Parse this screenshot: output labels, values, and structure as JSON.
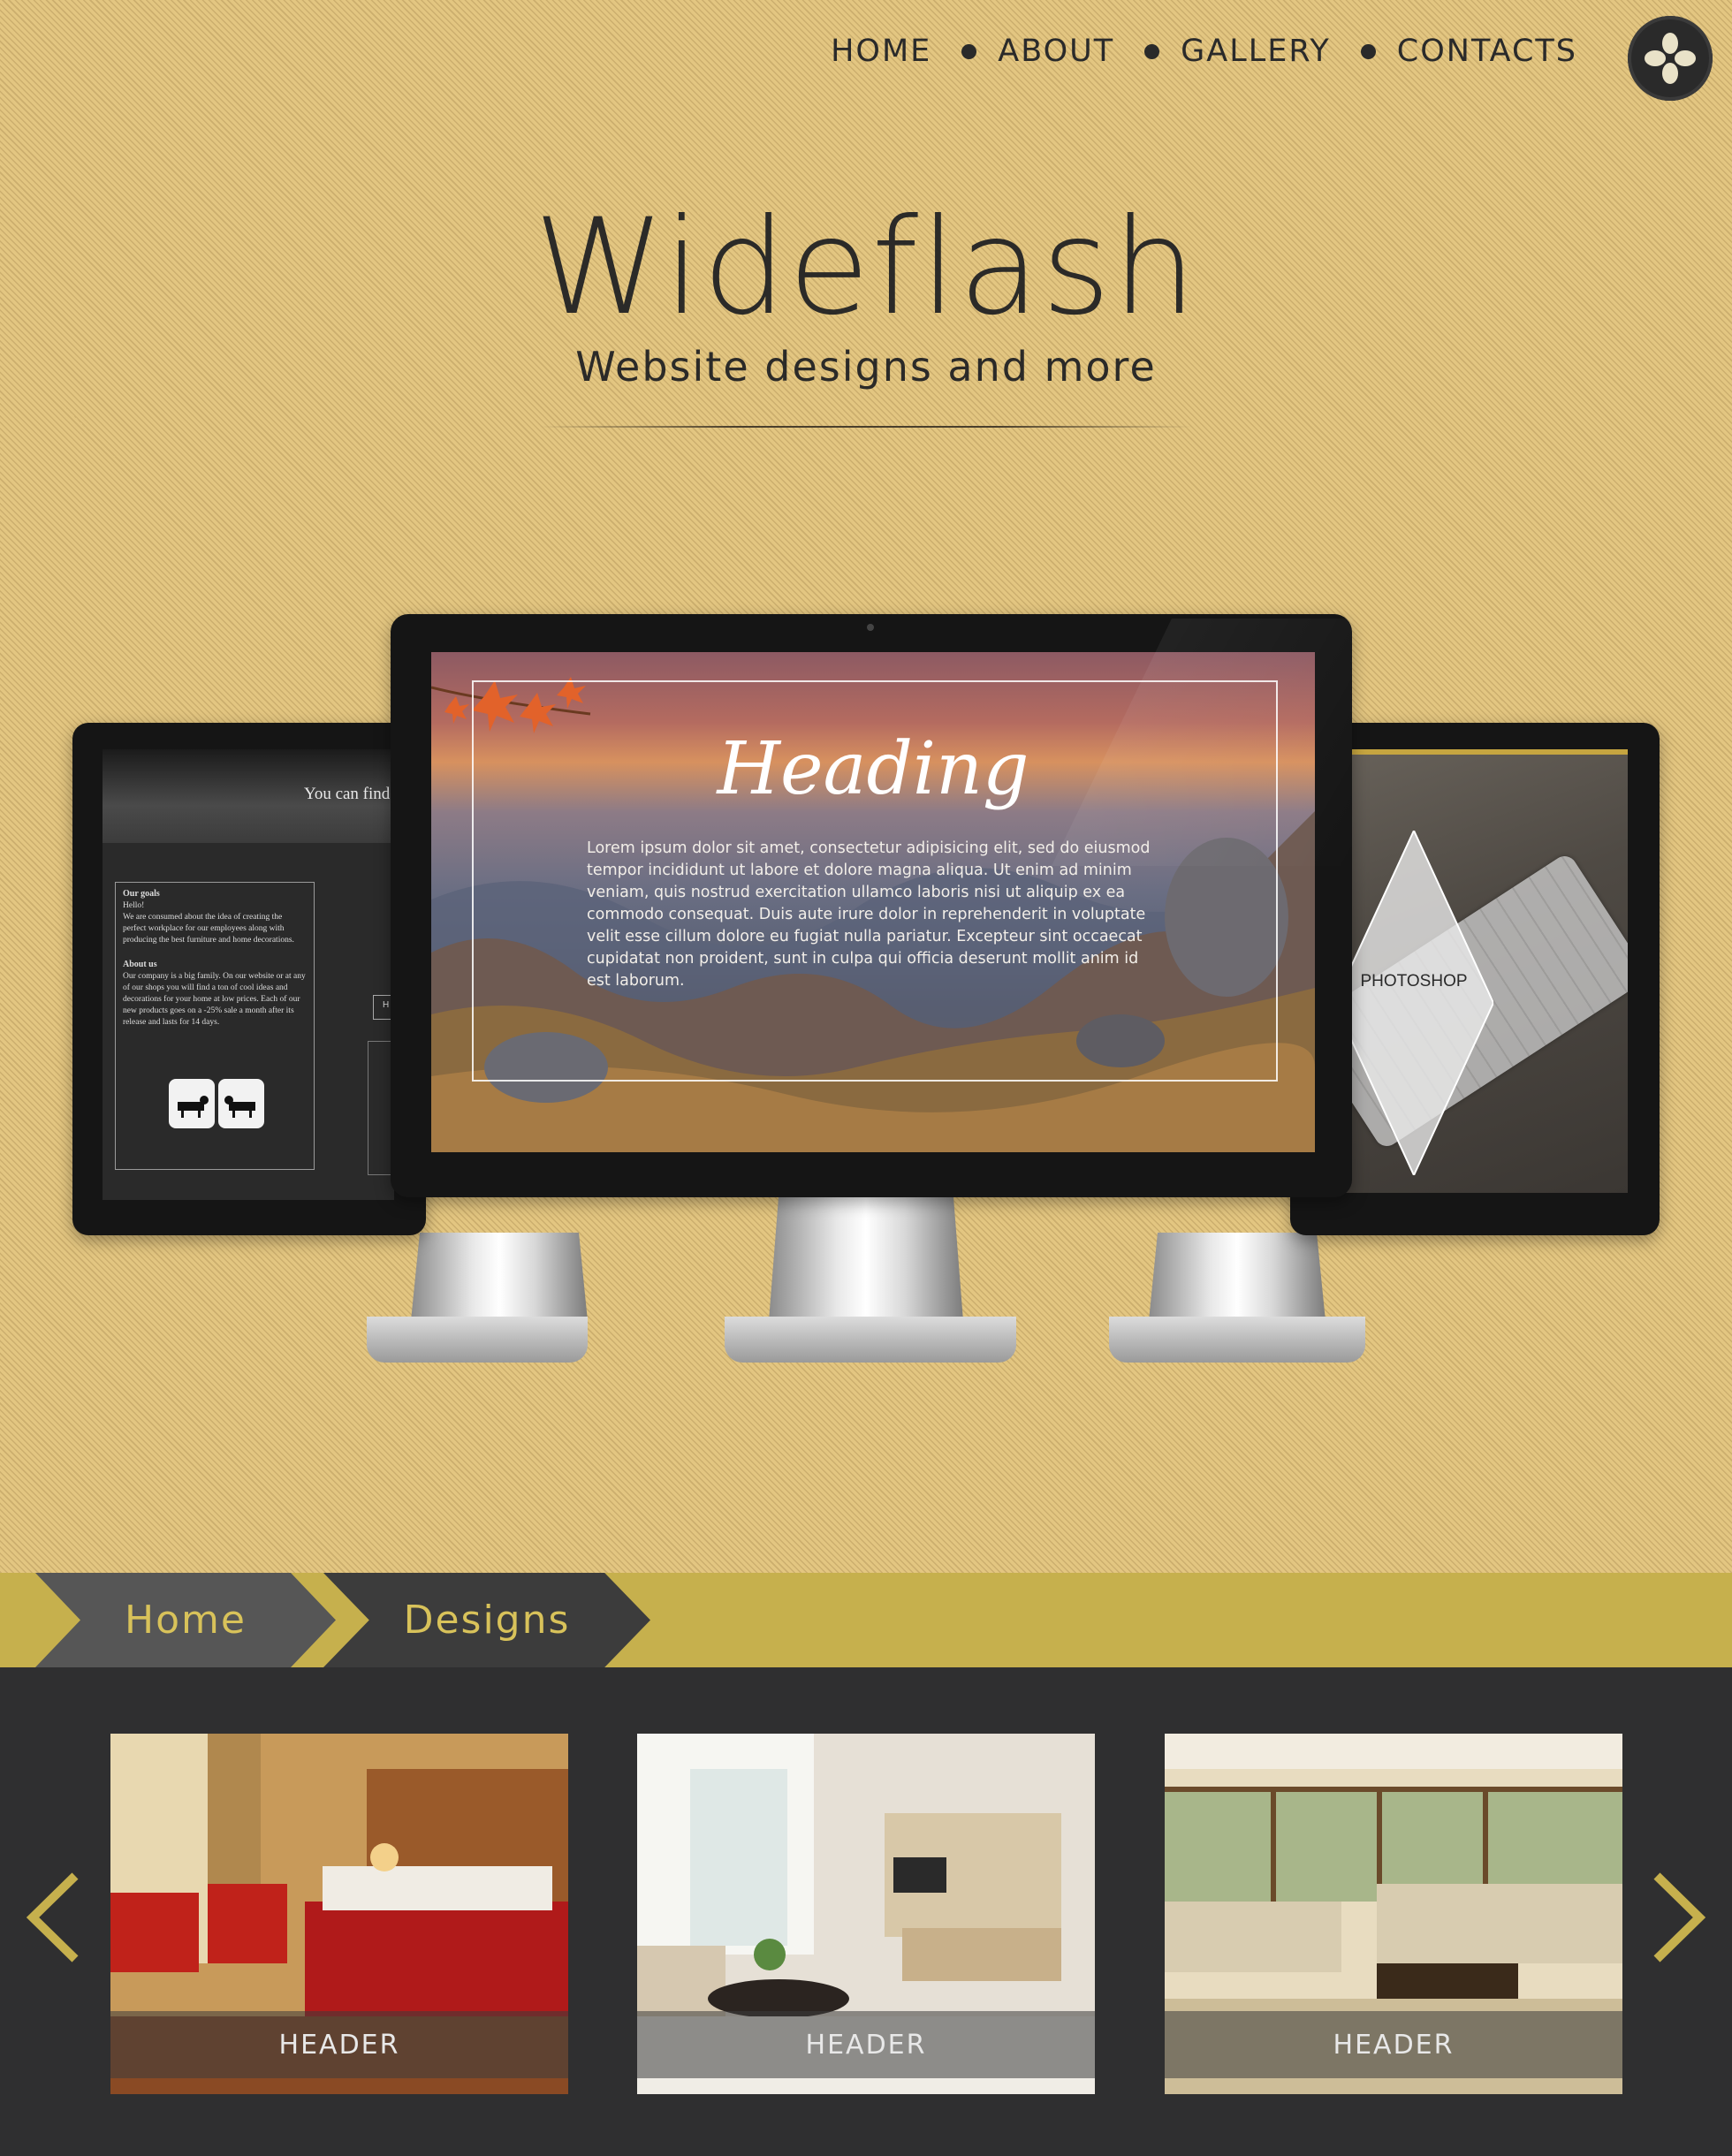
{
  "nav": {
    "items": [
      "HOME",
      "ABOUT",
      "GALLERY",
      "CONTACTS"
    ]
  },
  "hero": {
    "title": "Wideflash",
    "subtitle": "Website designs and more"
  },
  "left_screen": {
    "banner_text": "You can find",
    "goals_title": "Our goals",
    "goals_text": "Hello!\nWe are consumed about the idea of creating the perfect workplace for our employees along with producing the best furniture and home decorations.",
    "about_title": "About us",
    "about_text": "Our company is a big family. On our website or at any of our shops you will find a ton of cool ideas and decorations for your home at low prices. Each of our new products goes on a -25% sale a month after its release and lasts for 14 days.",
    "button_text": "H"
  },
  "center_screen": {
    "heading": "Heading",
    "body": "Lorem ipsum dolor sit amet, consectetur adipisicing elit, sed do eiusmod tempor incididunt ut labore et dolore magna aliqua. Ut enim ad minim veniam, quis nostrud exercitation ullamco laboris nisi ut aliquip ex ea commodo consequat. Duis aute irure dolor in reprehenderit in voluptate velit esse cillum dolore eu fugiat nulla pariatur. Excepteur sint occaecat cupidatat non proident, sunt in culpa qui officia deserunt mollit anim id est laborum."
  },
  "right_screen": {
    "label": "PHOTOSHOP"
  },
  "breadcrumb": {
    "home": "Home",
    "current": "Designs"
  },
  "gallery": {
    "cards": [
      {
        "caption": "HEADER"
      },
      {
        "caption": "HEADER"
      },
      {
        "caption": "HEADER"
      }
    ]
  },
  "colors": {
    "background": "#e3c681",
    "accent": "#c6b04d",
    "dark": "#2f2f30",
    "crumb_text": "#d8c25a"
  }
}
